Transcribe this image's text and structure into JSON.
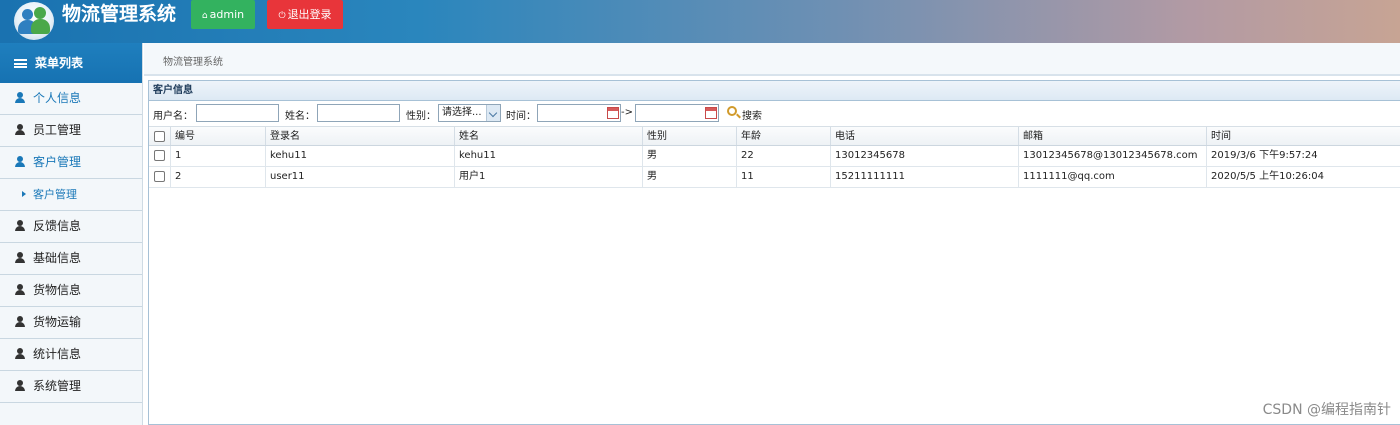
{
  "header": {
    "app_title": "物流管理系统",
    "admin_button": "admin",
    "logout_button": "退出登录"
  },
  "sidebar": {
    "title": "菜单列表",
    "items": [
      {
        "label": "个人信息",
        "active": true
      },
      {
        "label": "员工管理",
        "active": false
      },
      {
        "label": "客户管理",
        "active": true
      },
      {
        "label": "客户管理",
        "sub": true
      },
      {
        "label": "反馈信息",
        "active": false
      },
      {
        "label": "基础信息",
        "active": false
      },
      {
        "label": "货物信息",
        "active": false
      },
      {
        "label": "货物运输",
        "active": false
      },
      {
        "label": "统计信息",
        "active": false
      },
      {
        "label": "系统管理",
        "active": false
      }
    ]
  },
  "breadcrumb": "物流管理系统",
  "panel": {
    "title": "客户信息",
    "search": {
      "username_label": "用户名：",
      "username_value": "",
      "name_label": "姓名：",
      "name_value": "",
      "gender_label": "性别：",
      "gender_selected": "请选择...",
      "time_label": "时间：",
      "time_from": "",
      "time_separator": "->",
      "time_to": "",
      "search_button": "搜索"
    },
    "table": {
      "columns": [
        "编号",
        "登录名",
        "姓名",
        "性别",
        "年龄",
        "电话",
        "邮箱",
        "时间"
      ],
      "rows": [
        [
          "1",
          "kehu11",
          "kehu11",
          "男",
          "22",
          "13012345678",
          "13012345678@13012345678.com",
          "2019/3/6 下午9:57:24"
        ],
        [
          "2",
          "user11",
          "用户1",
          "男",
          "11",
          "15211111111",
          "1111111@qq.com",
          "2020/5/5 上午10:26:04"
        ]
      ]
    }
  },
  "watermark": "CSDN @编程指南针"
}
